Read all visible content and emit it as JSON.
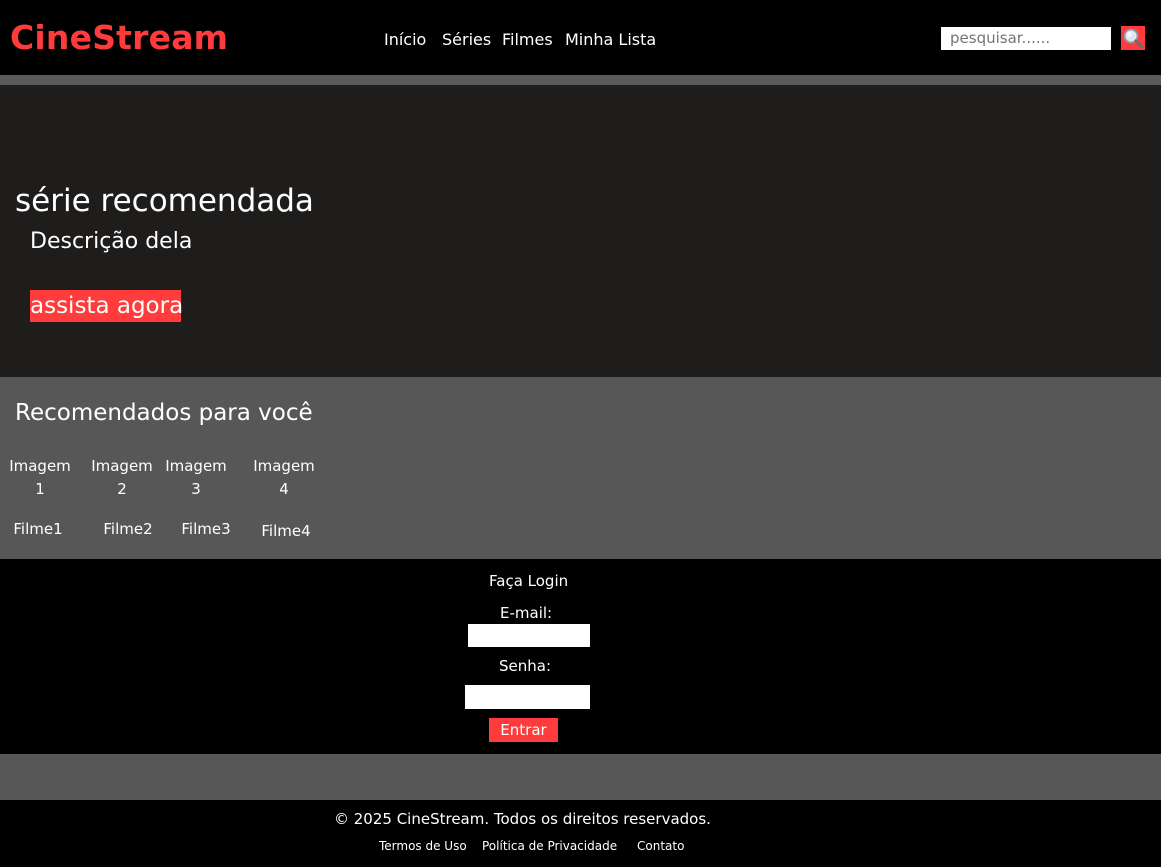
{
  "header": {
    "logo": "CineStream",
    "nav": [
      "Início",
      "Séries",
      "Filmes",
      "Minha Lista"
    ],
    "search_placeholder": "pesquisar......",
    "search_icon": "magnifier-icon"
  },
  "hero": {
    "title": "série recomendada",
    "description": "Descrição dela",
    "cta": "assista agora"
  },
  "recommended": {
    "title": "Recomendados para você",
    "items": [
      {
        "image": "Imagem 1",
        "title": "Filme1"
      },
      {
        "image": "Imagem 2",
        "title": "Filme2"
      },
      {
        "image": "Imagem 3",
        "title": "Filme3"
      },
      {
        "image": "Imagem 4",
        "title": "Filme4"
      }
    ]
  },
  "login": {
    "title": "Faça Login",
    "email_label": "E-mail:",
    "password_label": "Senha:",
    "submit": "Entrar"
  },
  "footer": {
    "copyright": "© 2025 CineStream. Todos os direitos reservados.",
    "links": [
      "Termos de Uso",
      "Política de Privacidade",
      "Contato"
    ]
  },
  "colors": {
    "accent": "#ff3b3b",
    "header_bg": "#000000",
    "hero_bg": "#1e1d1c",
    "section_bg": "#575757"
  }
}
